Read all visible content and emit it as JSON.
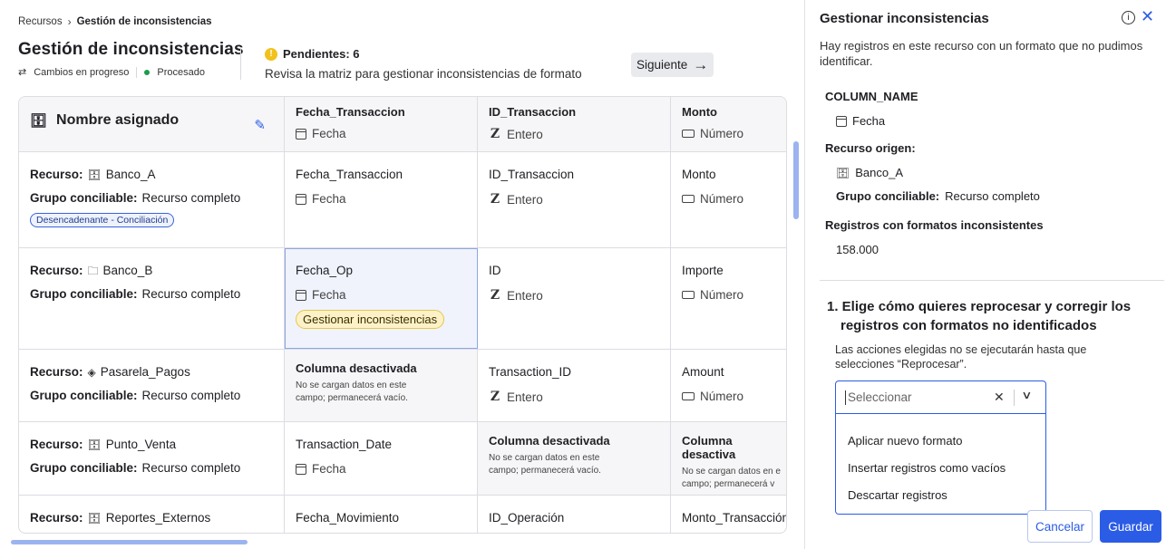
{
  "breadcrumb": {
    "root": "Recursos",
    "current": "Gestión de inconsistencias"
  },
  "page": {
    "title": "Gestión de inconsistencias",
    "status_changes": "Cambios en progreso",
    "status_processed": "Procesado",
    "pending_label": "Pendientes: 6",
    "pending_desc": "Revisa la matriz para gestionar inconsistencias de formato",
    "next_label": "Siguiente"
  },
  "table": {
    "header": {
      "name_col": "Nombre asignado",
      "cols": [
        {
          "name": "Fecha_Transaccion",
          "type": "Fecha"
        },
        {
          "name": "ID_Transaccion",
          "type": "Entero"
        },
        {
          "name": "Monto",
          "type": "Número"
        }
      ]
    },
    "labels": {
      "resource": "Recurso:",
      "group": "Grupo conciliable:",
      "group_value": "Recurso completo"
    },
    "rows": [
      {
        "resource": "Banco_A",
        "badge": "Desencadenante - Conciliación",
        "c1": {
          "name": "Fecha_Transaccion",
          "type": "Fecha"
        },
        "c2": {
          "name": "ID_Transaccion",
          "type": "Entero"
        },
        "c3": {
          "name": "Monto",
          "type": "Número"
        }
      },
      {
        "resource": "Banco_B",
        "action": "Gestionar inconsistencias",
        "c1": {
          "name": "Fecha_Op",
          "type": "Fecha"
        },
        "c2": {
          "name": "ID",
          "type": "Entero"
        },
        "c3": {
          "name": "Importe",
          "type": "Número"
        }
      },
      {
        "resource": "Pasarela_Pagos",
        "c1": {
          "disabled_title": "Columna desactivada",
          "disabled_desc_1": "No se cargan datos en este",
          "disabled_desc_2": "campo; permanecerá vacío."
        },
        "c2": {
          "name": "Transaction_ID",
          "type": "Entero"
        },
        "c3": {
          "name": "Amount",
          "type": "Número"
        }
      },
      {
        "resource": "Punto_Venta",
        "c1": {
          "name": "Transaction_Date",
          "type": "Fecha"
        },
        "c2": {
          "disabled_title": "Columna desactivada",
          "disabled_desc_1": "No se cargan datos en este",
          "disabled_desc_2": "campo; permanecerá vacío."
        },
        "c3": {
          "disabled_title": "Columna desactiva",
          "disabled_desc_1": "No se cargan datos en e",
          "disabled_desc_2": "campo; permanecerá v"
        }
      },
      {
        "resource": "Reportes_Externos",
        "c1": {
          "name": "Fecha_Movimiento"
        },
        "c2": {
          "name": "ID_Operación"
        },
        "c3": {
          "name": "Monto_Transacción"
        }
      }
    ]
  },
  "panel": {
    "title": "Gestionar inconsistencias",
    "desc": "Hay registros en este recurso con un formato que no pudimos identificar.",
    "column_label": "COLUMN_NAME",
    "column_value": "Fecha",
    "origin_label": "Recurso origen:",
    "origin_value": "Banco_A",
    "group_label": "Grupo conciliable:",
    "group_value": "Recurso completo",
    "inconsistent_label": "Registros con formatos inconsistentes",
    "inconsistent_value": "158.000",
    "step_title": "1. Elige cómo quieres reprocesar y corregir los registros con formatos no identificados",
    "step_desc": "Las acciones elegidas no se ejecutarán hasta que selecciones “Reprocesar”.",
    "select_placeholder": "Seleccionar",
    "options": [
      "Aplicar nuevo formato",
      "Insertar registros como vacíos",
      "Descartar registros"
    ],
    "cancel_label": "Cancelar",
    "save_label": "Guardar"
  },
  "colors": {
    "accent": "#2b5ce6",
    "warning": "#f2c21b",
    "success": "#1e9b4e"
  }
}
